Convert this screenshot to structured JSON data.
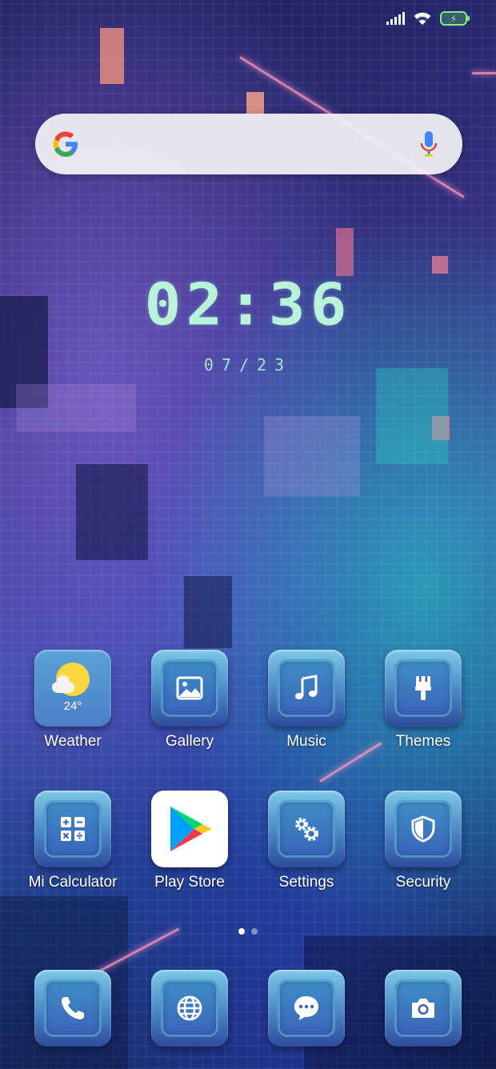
{
  "status_bar": {
    "signal_icon": "cellular-signal-icon",
    "wifi_icon": "wifi-icon",
    "battery_icon": "battery-charging-icon",
    "battery_color": "#7cf07a"
  },
  "search": {
    "logo_icon": "google-logo-icon",
    "mic_icon": "microphone-icon"
  },
  "clock": {
    "time": "02:36",
    "date": "07/23"
  },
  "home_apps": [
    {
      "label": "Weather",
      "icon": "weather-icon",
      "temp": "24°"
    },
    {
      "label": "Gallery",
      "icon": "gallery-icon"
    },
    {
      "label": "Music",
      "icon": "music-note-icon"
    },
    {
      "label": "Themes",
      "icon": "paintbrush-icon"
    },
    {
      "label": "Mi Calculator",
      "icon": "calculator-icon"
    },
    {
      "label": "Play Store",
      "icon": "play-store-icon"
    },
    {
      "label": "Settings",
      "icon": "gears-icon"
    },
    {
      "label": "Security",
      "icon": "shield-icon"
    }
  ],
  "page_indicator": {
    "pages": 2,
    "active": 1
  },
  "dock": [
    {
      "icon": "phone-icon"
    },
    {
      "icon": "browser-globe-icon"
    },
    {
      "icon": "messages-icon"
    },
    {
      "icon": "camera-icon"
    }
  ]
}
